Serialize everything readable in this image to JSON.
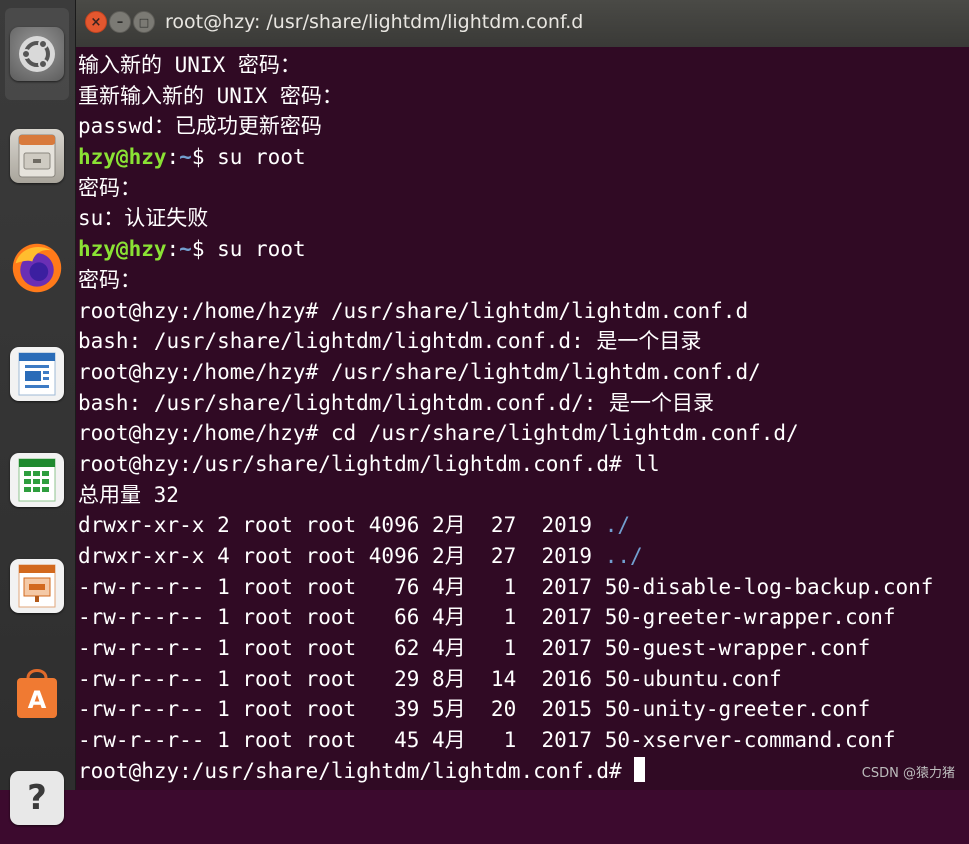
{
  "window": {
    "title": "root@hzy: /usr/share/lightdm/lightdm.conf.d",
    "close_glyph": "×",
    "minimize_glyph": "–",
    "maximize_glyph": "□"
  },
  "launcher": {
    "items": [
      {
        "name": "dash-home",
        "icon": "ubuntu-logo-icon"
      },
      {
        "name": "files",
        "icon": "file-cabinet-icon"
      },
      {
        "name": "firefox",
        "icon": "firefox-icon"
      },
      {
        "name": "libreoffice-writer",
        "icon": "writer-icon"
      },
      {
        "name": "libreoffice-calc",
        "icon": "calc-icon"
      },
      {
        "name": "libreoffice-impress",
        "icon": "impress-icon"
      },
      {
        "name": "software-center",
        "icon": "shopping-bag-icon"
      },
      {
        "name": "help",
        "icon": "help-icon"
      }
    ]
  },
  "terminal": {
    "lines": [
      {
        "text": "输入新的 UNIX 密码："
      },
      {
        "text": "重新输入新的 UNIX 密码："
      },
      {
        "text": "passwd：已成功更新密码"
      },
      {
        "user": "hzy@hzy",
        "sep": ":",
        "path": "~",
        "rest": "$ su root"
      },
      {
        "text": "密码："
      },
      {
        "text": "su：认证失败"
      },
      {
        "user": "hzy@hzy",
        "sep": ":",
        "path": "~",
        "rest": "$ su root"
      },
      {
        "text": "密码："
      },
      {
        "text": "root@hzy:/home/hzy# /usr/share/lightdm/lightdm.conf.d"
      },
      {
        "text": "bash: /usr/share/lightdm/lightdm.conf.d: 是一个目录"
      },
      {
        "text": "root@hzy:/home/hzy# /usr/share/lightdm/lightdm.conf.d/"
      },
      {
        "text": "bash: /usr/share/lightdm/lightdm.conf.d/: 是一个目录"
      },
      {
        "text": "root@hzy:/home/hzy# cd /usr/share/lightdm/lightdm.conf.d/"
      },
      {
        "text": "root@hzy:/usr/share/lightdm/lightdm.conf.d# ll"
      },
      {
        "text": "总用量 32"
      },
      {
        "text": "drwxr-xr-x 2 root root 4096 2月  27  2019 ",
        "dir": "./"
      },
      {
        "text": "drwxr-xr-x 4 root root 4096 2月  27  2019 ",
        "dir": "../"
      },
      {
        "text": "-rw-r--r-- 1 root root   76 4月   1  2017 50-disable-log-backup.conf"
      },
      {
        "text": "-rw-r--r-- 1 root root   66 4月   1  2017 50-greeter-wrapper.conf"
      },
      {
        "text": "-rw-r--r-- 1 root root   62 4月   1  2017 50-guest-wrapper.conf"
      },
      {
        "text": "-rw-r--r-- 1 root root   29 8月  14  2016 50-ubuntu.conf"
      },
      {
        "text": "-rw-r--r-- 1 root root   39 5月  20  2015 50-unity-greeter.conf"
      },
      {
        "text": "-rw-r--r-- 1 root root   45 4月   1  2017 50-xserver-command.conf"
      },
      {
        "text": "root@hzy:/usr/share/lightdm/lightdm.conf.d# ",
        "cursor": true
      }
    ]
  },
  "watermark": "CSDN @猿力猪",
  "colors": {
    "terminal_bg": "#300a24",
    "prompt_user": "#8ae234",
    "prompt_path": "#729fcf",
    "directory": "#729fcf",
    "text": "#ffffff"
  }
}
